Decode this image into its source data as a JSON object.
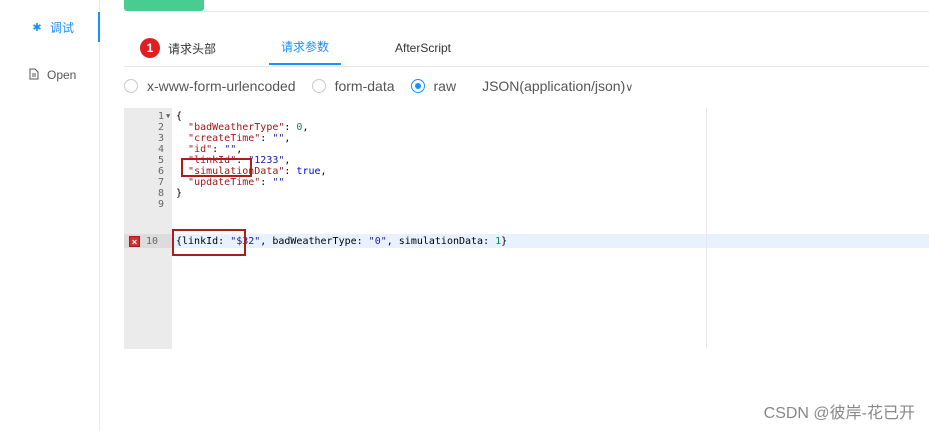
{
  "sidebar": {
    "items": [
      {
        "label": "调试",
        "icon": "bug-icon",
        "active": true
      },
      {
        "label": "Open",
        "icon": "document-icon",
        "active": false
      }
    ]
  },
  "request": {
    "method_color": "#49cc90"
  },
  "tabs": [
    {
      "label": "请求头部",
      "badge": "1",
      "active": false
    },
    {
      "label": "请求参数",
      "active": true
    },
    {
      "label": "AfterScript",
      "active": false
    }
  ],
  "body_types": {
    "options": [
      "x-www-form-urlencoded",
      "form-data",
      "raw"
    ],
    "selected": "raw",
    "content_type": "JSON(application/json)"
  },
  "editor": {
    "lines": [
      {
        "num": "1",
        "fold": true
      },
      {
        "num": "2"
      },
      {
        "num": "3"
      },
      {
        "num": "4"
      },
      {
        "num": "5"
      },
      {
        "num": "6"
      },
      {
        "num": "7"
      },
      {
        "num": "8"
      },
      {
        "num": "9"
      },
      {
        "num": "10",
        "error": true
      }
    ],
    "code": {
      "l1": "{",
      "l2_key": "\"badWeatherType\"",
      "l2_val": "0",
      "l3_key": "\"createTime\"",
      "l3_val": "\"\"",
      "l4_key": "\"id\"",
      "l4_val": "\"\"",
      "l5_key": "\"linkId\"",
      "l5_val": "\"1233\"",
      "l6_key": "\"simulationData\"",
      "l6_val": "true",
      "l7_key": "\"updateTime\"",
      "l7_val": "\"\"",
      "l8": "}",
      "l10_a": "{linkId: ",
      "l10_b": "\"$32\"",
      "l10_c": ", badWeatherType: ",
      "l10_d": "\"0\"",
      "l10_e": ", simulationData: ",
      "l10_f": "1",
      "l10_g": "}"
    },
    "error_marker": "×"
  },
  "watermark": "CSDN @彼岸-花已开",
  "colors": {
    "accent": "#1890ff",
    "error": "#d03030",
    "highlight_box": "#b01b1b"
  }
}
